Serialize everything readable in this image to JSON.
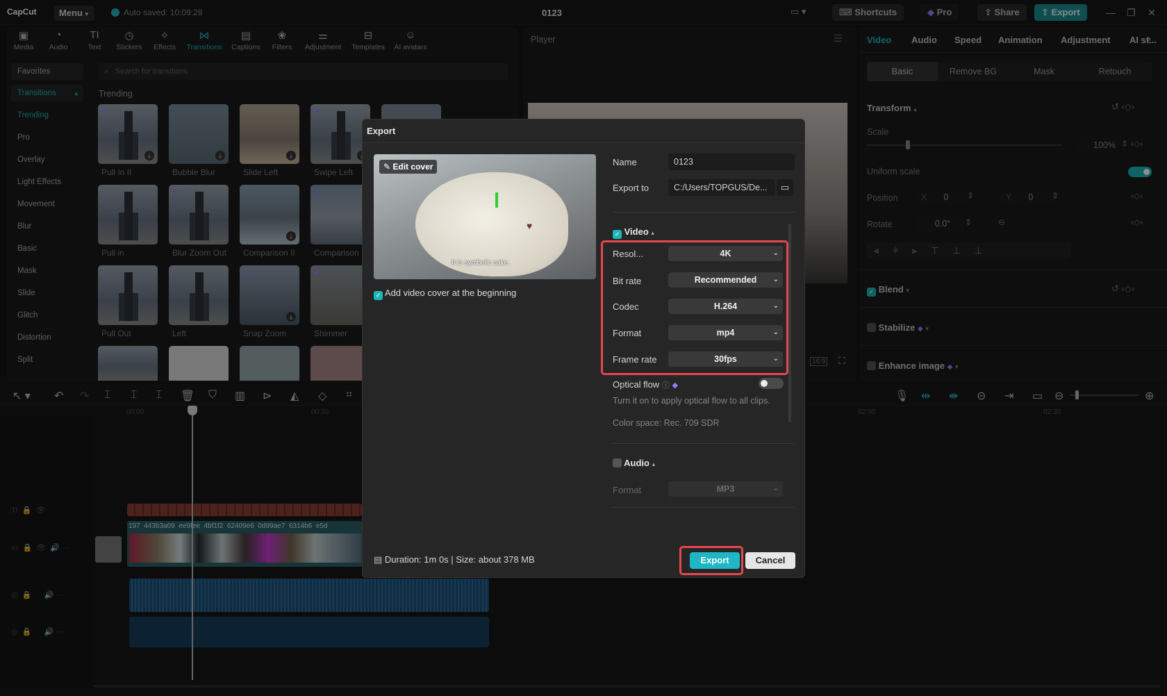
{
  "topbar": {
    "logo": "CapCut",
    "menu": "Menu",
    "autosave": "Auto saved: 10:09:28",
    "project_title": "0123",
    "shortcuts": "Shortcuts",
    "pro": "Pro",
    "share": "Share",
    "export": "Export"
  },
  "media_toolbar": [
    "Media",
    "Audio",
    "Text",
    "Stickers",
    "Effects",
    "Transitions",
    "Captions",
    "Filters",
    "Adjustment",
    "Templates",
    "AI avatars"
  ],
  "transitions": {
    "favorites": "Favorites",
    "section": "Transitions",
    "categories": [
      "Trending",
      "Pro",
      "Overlay",
      "Light Effects",
      "Movement",
      "Blur",
      "Basic",
      "Mask",
      "Slide",
      "Glitch",
      "Distortion",
      "Split"
    ],
    "search_placeholder": "Search for transitions",
    "heading": "Trending",
    "items": [
      "Pull In II",
      "Bubble Blur",
      "Slide Left",
      "Swipe Left",
      "Pull in",
      "Blur Zoom Out",
      "Comparison II",
      "Comparison",
      "Pull Out",
      "Left",
      "Snap Zoom",
      "Shimmer"
    ]
  },
  "player": {
    "title": "Player",
    "ratio": "16:9"
  },
  "right_panel": {
    "tabs": [
      "Video",
      "Audio",
      "Speed",
      "Animation",
      "Adjustment",
      "AI st..."
    ],
    "subtabs": [
      "Basic",
      "Remove BG",
      "Mask",
      "Retouch"
    ],
    "transform": "Transform",
    "scale_label": "Scale",
    "scale_value": "100%",
    "uniform_scale": "Uniform scale",
    "position_label": "Position",
    "pos_x_label": "X",
    "pos_x": "0",
    "pos_y_label": "Y",
    "pos_y": "0",
    "rotate_label": "Rotate",
    "rotate_value": "0.0°",
    "blend": "Blend",
    "stabilize": "Stabilize",
    "enhance_image": "Enhance image"
  },
  "timeline": {
    "marks": [
      "00:00",
      "00:30",
      "02:00",
      "02:30"
    ],
    "clip_ids": [
      "197",
      "443b3a09",
      "ee9fee",
      "4bf1f2",
      "62409e6",
      "0d99ae7",
      "6314b6",
      "e5d"
    ]
  },
  "export_dialog": {
    "title": "Export",
    "edit_cover": "Edit cover",
    "cover_caption": "It is symbolic cake.",
    "add_cover": "Add video cover at the beginning",
    "name_label": "Name",
    "name_value": "0123",
    "export_to_label": "Export to",
    "export_to_value": "C:/Users/TOPGUS/De...",
    "video_section": "Video",
    "resolution_label": "Resol...",
    "resolution_value": "4K",
    "bitrate_label": "Bit rate",
    "bitrate_value": "Recommended",
    "codec_label": "Codec",
    "codec_value": "H.264",
    "format_label": "Format",
    "format_value": "mp4",
    "framerate_label": "Frame rate",
    "framerate_value": "30fps",
    "optical_flow_label": "Optical flow",
    "optical_flow_desc": "Turn it on to apply optical flow to all clips.",
    "color_space": "Color space: Rec. 709 SDR",
    "audio_section": "Audio",
    "audio_format_label": "Format",
    "audio_format_value": "MP3",
    "duration_size": "Duration: 1m 0s | Size: about 378 MB",
    "export_button": "Export",
    "cancel_button": "Cancel"
  },
  "colors": {
    "accent": "#1fb6b8",
    "highlight": "#e5484d"
  }
}
